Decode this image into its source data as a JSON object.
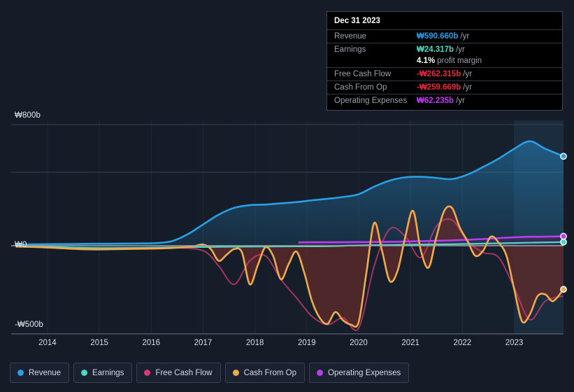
{
  "chart_data": {
    "type": "area",
    "title": "",
    "xlabel": "",
    "ylabel": "",
    "currency": "₩",
    "unit": "b",
    "xlim": [
      2013.3,
      2023.95
    ],
    "ylim": [
      -500,
      800
    ],
    "ytick_labels": [
      "₩800b",
      "₩0",
      "-₩500b"
    ],
    "ytick_values": [
      800,
      0,
      -500
    ],
    "xtick_labels": [
      "2014",
      "2015",
      "2016",
      "2017",
      "2018",
      "2019",
      "2020",
      "2021",
      "2022",
      "2023"
    ],
    "xtick_values": [
      2014,
      2015,
      2016,
      2017,
      2018,
      2019,
      2020,
      2021,
      2022,
      2023
    ],
    "grid": true,
    "legend_position": "bottom",
    "series": [
      {
        "name": "Revenue",
        "color": "#2a9fe5",
        "fill": "#1d4a66",
        "x": [
          2013.4,
          2013.7,
          2014.0,
          2014.3,
          2014.6,
          2014.9,
          2015.2,
          2015.5,
          2015.8,
          2016.1,
          2016.4,
          2016.7,
          2017.0,
          2017.3,
          2017.6,
          2017.9,
          2018.2,
          2018.5,
          2018.8,
          2019.1,
          2019.4,
          2019.7,
          2020.0,
          2020.3,
          2020.6,
          2020.9,
          2021.2,
          2021.5,
          2021.8,
          2022.1,
          2022.4,
          2022.7,
          2023.0,
          2023.3,
          2023.6,
          2023.95
        ],
        "values": [
          8,
          9,
          10,
          11,
          12,
          13,
          13,
          14,
          15,
          17,
          30,
          75,
          140,
          205,
          250,
          268,
          272,
          280,
          288,
          300,
          310,
          322,
          340,
          390,
          430,
          452,
          455,
          448,
          440,
          470,
          520,
          575,
          640,
          690,
          640,
          591
        ]
      },
      {
        "name": "Earnings",
        "color": "#4ad9c4",
        "x": [
          2013.4,
          2014.0,
          2014.6,
          2015.2,
          2015.8,
          2016.4,
          2017.0,
          2017.6,
          2018.2,
          2018.8,
          2019.4,
          2020.0,
          2020.6,
          2021.2,
          2021.8,
          2022.4,
          2023.0,
          2023.6,
          2023.95
        ],
        "values": [
          -2,
          -6,
          -12,
          -14,
          -13,
          -10,
          -8,
          -6,
          -5,
          -4,
          -3,
          2,
          5,
          8,
          10,
          14,
          18,
          22,
          24
        ]
      },
      {
        "name": "Free Cash Flow",
        "color": "#d63a72",
        "x": [
          2013.4,
          2014.0,
          2014.6,
          2015.2,
          2015.8,
          2016.4,
          2017.0,
          2017.3,
          2017.6,
          2017.9,
          2018.2,
          2018.5,
          2018.8,
          2019.1,
          2019.4,
          2019.7,
          2020.0,
          2020.3,
          2020.6,
          2020.9,
          2021.2,
          2021.5,
          2021.8,
          2022.1,
          2022.4,
          2022.7,
          2023.0,
          2023.3,
          2023.6,
          2023.95
        ],
        "values": [
          -4,
          -10,
          -18,
          -20,
          -16,
          -12,
          -30,
          -120,
          -230,
          -90,
          -60,
          -200,
          -310,
          -420,
          -470,
          -430,
          -490,
          -120,
          110,
          60,
          -70,
          130,
          170,
          30,
          -40,
          -70,
          -250,
          -440,
          -330,
          -300
        ]
      },
      {
        "name": "Cash From Op",
        "color": "#eeab4e",
        "fill": "#5f2a2c",
        "x": [
          2013.4,
          2013.8,
          2014.2,
          2014.6,
          2015.0,
          2015.4,
          2015.8,
          2016.2,
          2016.5,
          2016.8,
          2017.0,
          2017.15,
          2017.3,
          2017.45,
          2017.6,
          2017.75,
          2017.9,
          2018.05,
          2018.2,
          2018.35,
          2018.5,
          2018.65,
          2018.8,
          2018.95,
          2019.1,
          2019.25,
          2019.4,
          2019.55,
          2019.7,
          2019.85,
          2020.0,
          2020.15,
          2020.3,
          2020.45,
          2020.6,
          2020.75,
          2020.9,
          2021.05,
          2021.2,
          2021.35,
          2021.5,
          2021.65,
          2021.8,
          2021.95,
          2022.1,
          2022.25,
          2022.4,
          2022.55,
          2022.7,
          2022.85,
          2023.0,
          2023.15,
          2023.3,
          2023.45,
          2023.6,
          2023.75,
          2023.95
        ],
        "values": [
          -5,
          -8,
          -14,
          -20,
          -22,
          -20,
          -18,
          -16,
          -12,
          -5,
          8,
          -20,
          -90,
          -55,
          -20,
          -40,
          -230,
          -120,
          -10,
          -60,
          -200,
          -110,
          -35,
          -160,
          -330,
          -430,
          -465,
          -395,
          -445,
          -470,
          -455,
          -160,
          150,
          -30,
          -210,
          -150,
          60,
          230,
          -30,
          -130,
          60,
          230,
          250,
          120,
          30,
          -60,
          -30,
          60,
          20,
          -60,
          -260,
          -450,
          -410,
          -300,
          -290,
          -330,
          -260
        ]
      },
      {
        "name": "Operating Expenses",
        "color": "#b83ef0",
        "fill": "#3a2a57",
        "x": [
          2018.85,
          2019.2,
          2019.6,
          2020.0,
          2020.4,
          2020.8,
          2021.2,
          2021.6,
          2022.0,
          2022.4,
          2022.8,
          2023.2,
          2023.6,
          2023.95
        ],
        "values": [
          22,
          23,
          23,
          24,
          25,
          27,
          30,
          33,
          38,
          44,
          52,
          58,
          60,
          62
        ]
      }
    ],
    "endpoints": [
      {
        "name": "Revenue",
        "value": 590.66,
        "color": "#2a9fe5"
      },
      {
        "name": "Operating Expenses",
        "value": 62.235,
        "color": "#b83ef0"
      },
      {
        "name": "Earnings",
        "value": 24.317,
        "color": "#4ad9c4"
      },
      {
        "name": "Cash From Op",
        "value": -259.669,
        "color": "#eeab4e"
      }
    ],
    "highlight_region": {
      "from": 2023.0,
      "to": 2023.95
    }
  },
  "tooltip": {
    "title": "Dec 31 2023",
    "rows": [
      {
        "label": "Revenue",
        "value": "₩590.660b",
        "unit": "/yr",
        "color": "#2a9fe5"
      },
      {
        "label": "Earnings",
        "value": "₩24.317b",
        "unit": "/yr",
        "color": "#4ad9c4"
      },
      {
        "label": "",
        "value": "4.1%",
        "unit": "profit margin",
        "color": "#ffffff"
      },
      {
        "label": "Free Cash Flow",
        "value": "-₩262.315b",
        "unit": "/yr",
        "color": "#e8293a"
      },
      {
        "label": "Cash From Op",
        "value": "-₩259.669b",
        "unit": "/yr",
        "color": "#e8293a"
      },
      {
        "label": "Operating Expenses",
        "value": "₩62.235b",
        "unit": "/yr",
        "color": "#c13df5"
      }
    ]
  },
  "legend": {
    "items": [
      {
        "label": "Revenue",
        "color": "#2a9fe5"
      },
      {
        "label": "Earnings",
        "color": "#4ad9c4"
      },
      {
        "label": "Free Cash Flow",
        "color": "#d63a72"
      },
      {
        "label": "Cash From Op",
        "color": "#eeab4e"
      },
      {
        "label": "Operating Expenses",
        "color": "#b83ef0"
      }
    ]
  },
  "axis": {
    "y_labels": [
      {
        "text": "₩800b"
      },
      {
        "text": "₩0"
      },
      {
        "text": "-₩500b"
      }
    ]
  }
}
